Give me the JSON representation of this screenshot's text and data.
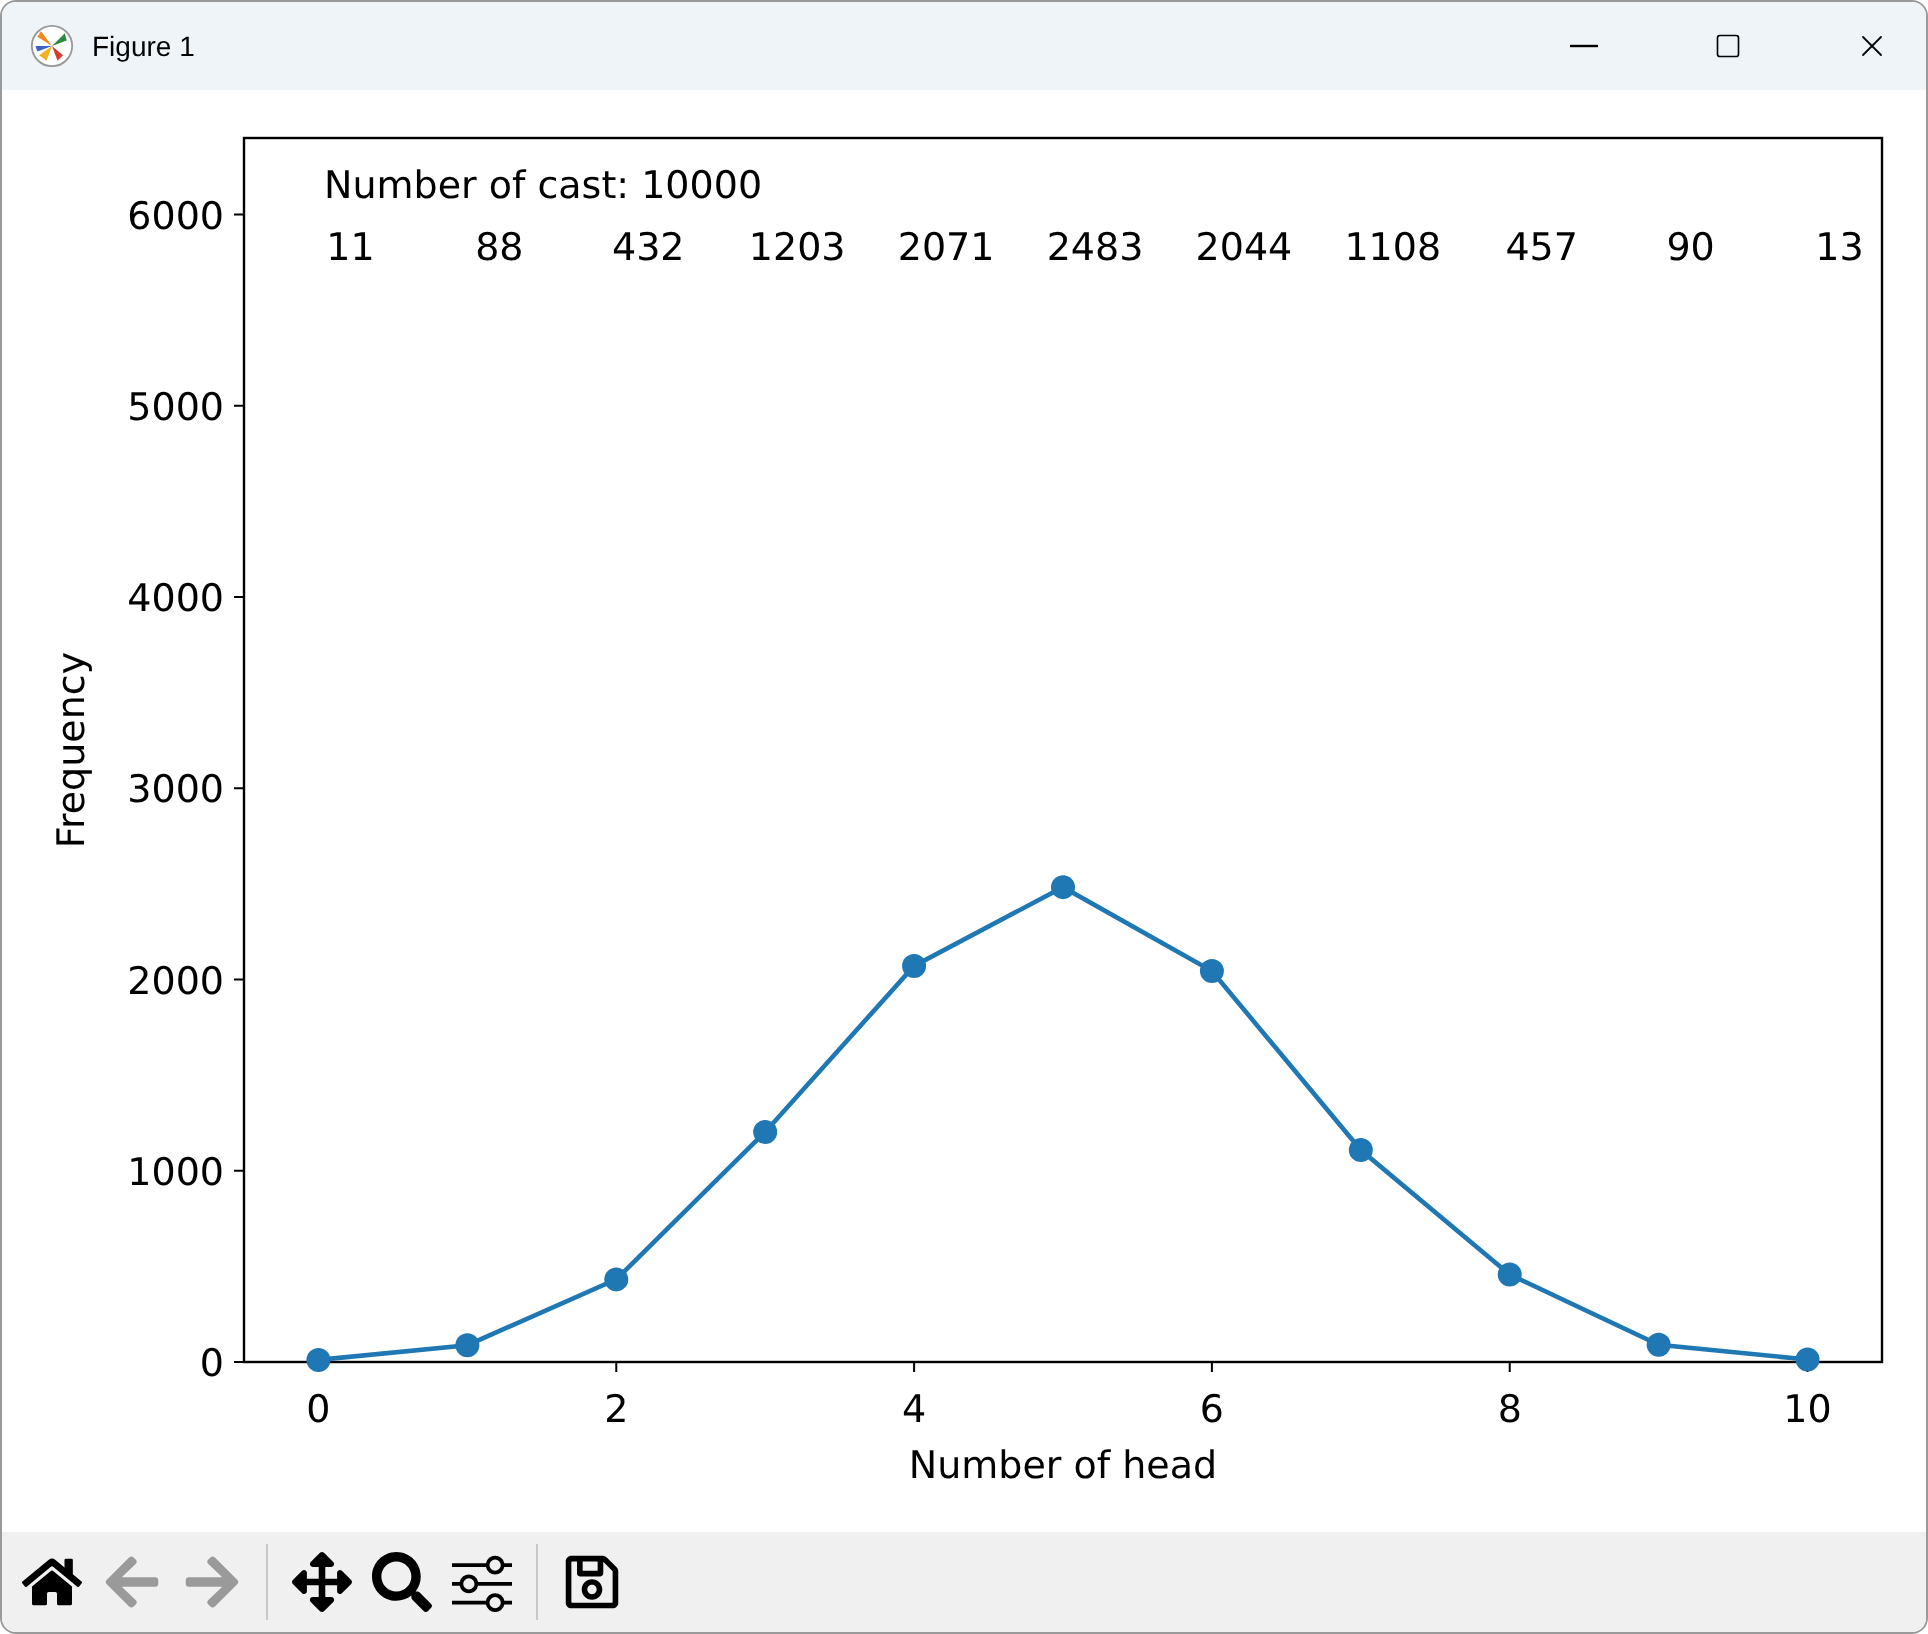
{
  "window": {
    "title": "Figure 1"
  },
  "figure": {
    "chart_data": {
      "type": "line",
      "xlabel": "Number of head",
      "ylabel": "Frequency",
      "x": [
        0,
        1,
        2,
        3,
        4,
        5,
        6,
        7,
        8,
        9,
        10
      ],
      "series": [
        {
          "color": "#1f77b4",
          "marker": "o",
          "values": [
            11,
            88,
            432,
            1203,
            2071,
            2483,
            2044,
            1108,
            457,
            90,
            13
          ]
        }
      ],
      "xlim": [
        -0.5,
        10.5
      ],
      "ylim": [
        0,
        6400
      ],
      "xticks": [
        0,
        2,
        4,
        6,
        8,
        10
      ],
      "yticks": [
        0,
        1000,
        2000,
        3000,
        4000,
        5000,
        6000
      ],
      "value_labels": [
        "11",
        "88",
        "432",
        "1203",
        "2071",
        "2483",
        "2044",
        "1108",
        "457",
        "90",
        "13"
      ],
      "annotations": [
        "Number of cast: 10000"
      ]
    }
  },
  "toolbar": {
    "groups": [
      [
        {
          "kind": "home",
          "disabled": false
        },
        {
          "kind": "back",
          "disabled": true
        },
        {
          "kind": "forward",
          "disabled": true
        }
      ],
      [
        {
          "kind": "pan",
          "disabled": false
        },
        {
          "kind": "zoom",
          "disabled": false
        },
        {
          "kind": "configure",
          "disabled": false
        }
      ],
      [
        {
          "kind": "save",
          "disabled": false
        }
      ]
    ]
  }
}
